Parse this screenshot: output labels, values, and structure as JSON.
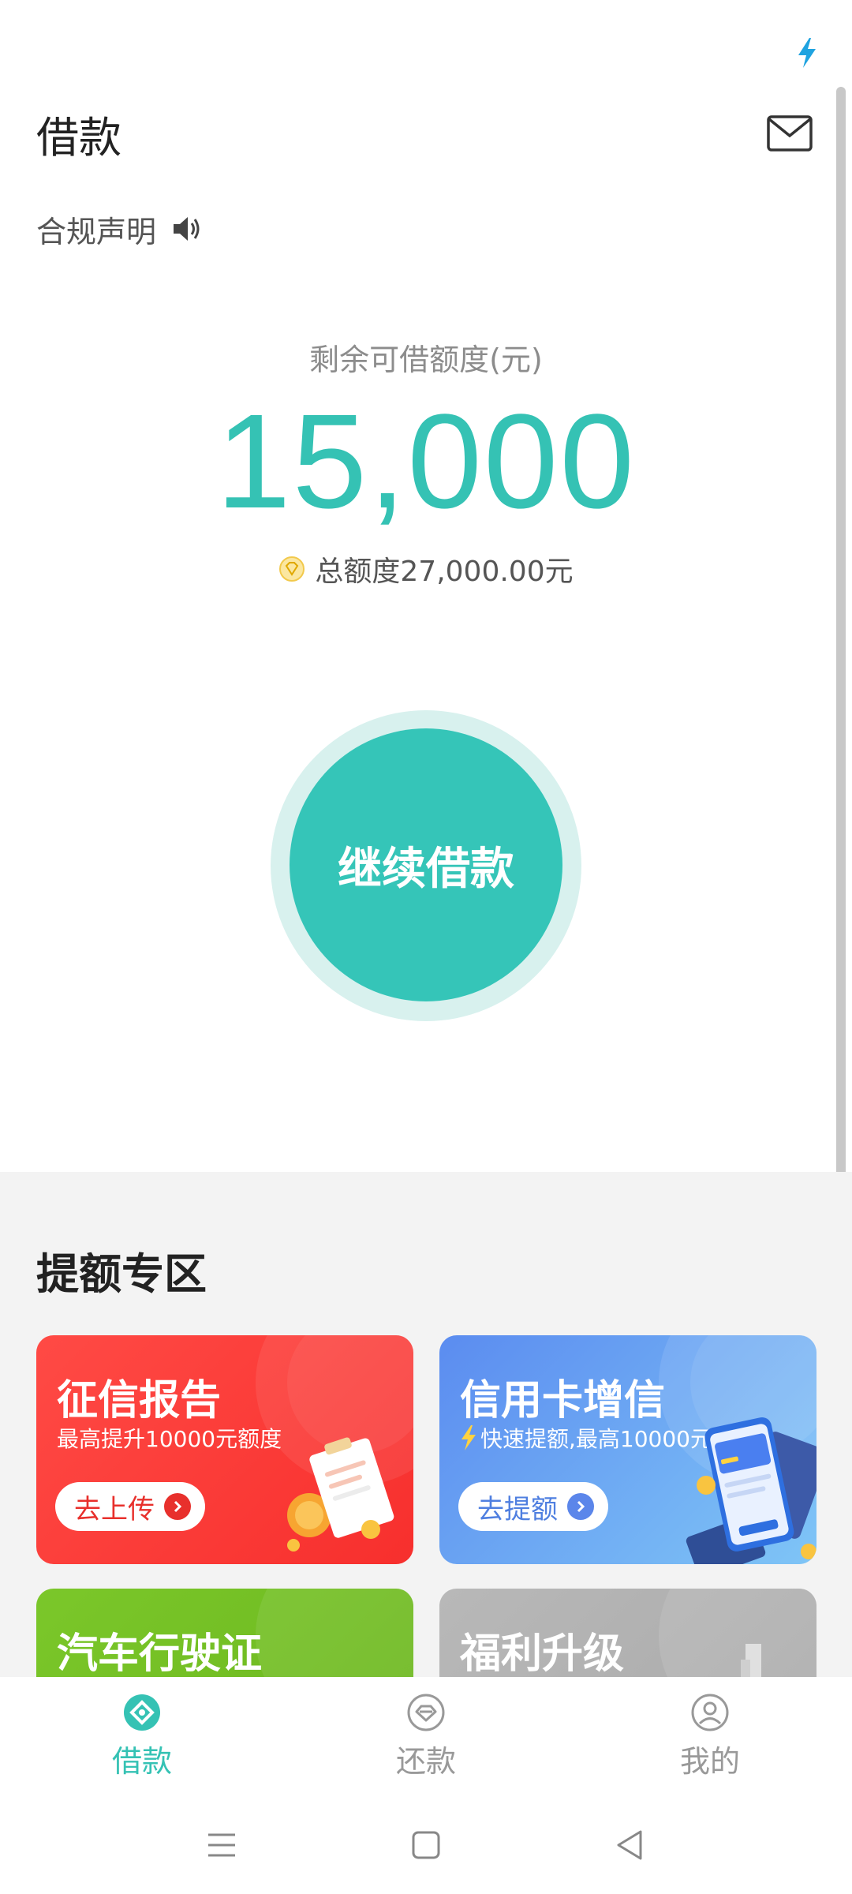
{
  "colors": {
    "accent": "#35c2b4",
    "button": "#35c5b8",
    "ring": "#d8f1ee",
    "red_card": "#f72f2d",
    "blue_card": "#5b8cf0",
    "green_card": "#7bc72a",
    "gray_card": "#b0b0b0",
    "tab_inactive": "#999999"
  },
  "status_bar": {
    "icon": "bolt-icon"
  },
  "header": {
    "title": "借款",
    "mail_icon": "mail-icon"
  },
  "compliance": {
    "label": "合规声明",
    "icon": "speaker-icon"
  },
  "credit": {
    "label": "剩余可借额度(元)",
    "amount": "15,000",
    "total_text": "总额度27,000.00元",
    "total_icon": "diamond-badge-icon"
  },
  "borrow_button": {
    "label": "继续借款"
  },
  "promo": {
    "title": "提额专区",
    "cards": [
      {
        "title": "征信报告",
        "subtitle": "最高提升10000元额度",
        "button": "去上传",
        "color": "#f72f2d"
      },
      {
        "title": "信用卡增信",
        "subtitle": "快速提额,最高10000元",
        "button": "去提额",
        "color": "#5b8cf0"
      },
      {
        "title": "汽车行驶证",
        "color": "#7bc72a"
      },
      {
        "title": "福利升级",
        "color": "#b0b0b0"
      }
    ]
  },
  "tabs": [
    {
      "label": "借款",
      "icon": "borrow-icon",
      "active": true
    },
    {
      "label": "还款",
      "icon": "repay-icon",
      "active": false
    },
    {
      "label": "我的",
      "icon": "profile-icon",
      "active": false
    }
  ],
  "system_nav": {
    "menu_icon": "menu-icon",
    "home_icon": "home-icon",
    "back_icon": "back-icon"
  }
}
